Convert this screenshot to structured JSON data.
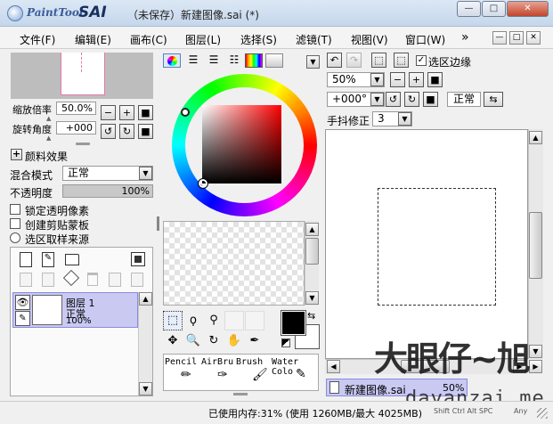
{
  "window": {
    "logo_text": "PaintTool",
    "logo_sai": "SAI",
    "title": "（未保存）新建图像.sai (*)",
    "min_label": "—",
    "max_label": "□",
    "close_label": "✕"
  },
  "menu": {
    "items": [
      "文件(F)",
      "编辑(E)",
      "画布(C)",
      "图层(L)",
      "选择(S)",
      "滤镜(T)",
      "视图(V)",
      "窗口(W)"
    ],
    "more": "»",
    "mdi_min": "—",
    "mdi_max": "□",
    "mdi_close": "✕"
  },
  "navigator": {
    "zoom_label": "缩放倍率",
    "zoom_value": "50.0%",
    "rotate_label": "旋转角度",
    "rotate_value": "+000"
  },
  "layer_props": {
    "effects_label": "颜料效果",
    "blend_label": "混合模式",
    "blend_value": "正常",
    "opacity_label": "不透明度",
    "opacity_value": "100%",
    "opacity_fraction": 1.0,
    "lock_alpha": "锁定透明像素",
    "clipping": "创建剪贴蒙板",
    "selection_source": "选区取样来源"
  },
  "layers": [
    {
      "name": "图层 1",
      "mode": "正常",
      "opacity": "100%"
    }
  ],
  "color": {
    "hue_ring": true,
    "primary": "#000000",
    "secondary": "#ffffff"
  },
  "tools": {
    "brushes": [
      {
        "name": "Pencil"
      },
      {
        "name": "AirBru"
      },
      {
        "name": "Brush"
      },
      {
        "name": "Water",
        "sub": "Colo"
      }
    ]
  },
  "canvas_toolbar": {
    "zoom_value": "50%",
    "rotate_value": "+000°",
    "selection_edge": "选区边缘",
    "blend_value": "正常",
    "stabilizer_label": "手抖修正",
    "stabilizer_value": "3"
  },
  "tab": {
    "name": "新建图像.sai",
    "zoom": "50%"
  },
  "status": {
    "memory": "已使用内存:31% (使用 1260MB/最大 4025MB)",
    "keys": "Shift Ctrl Alt SPC",
    "any": "Any"
  },
  "watermark": {
    "text1": "大眼仔~旭",
    "text2": "dayanzai.me"
  },
  "accent": "#8a8ae0"
}
